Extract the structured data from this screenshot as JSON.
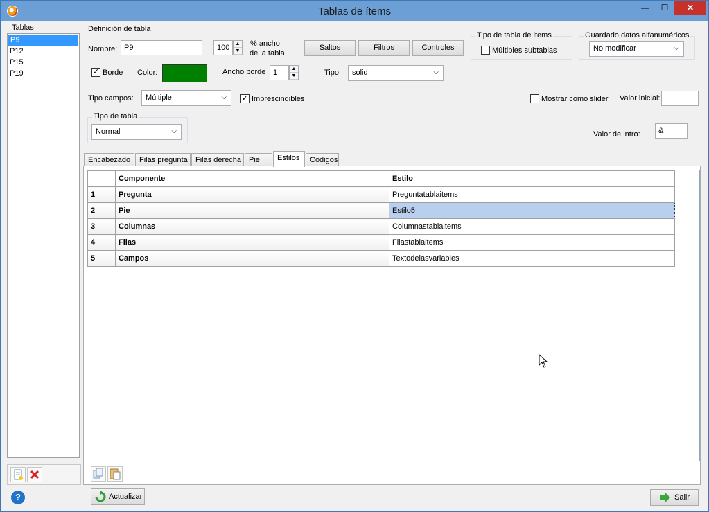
{
  "window": {
    "title": "Tablas de ítems"
  },
  "tablas": {
    "label": "Tablas",
    "items": [
      "P9",
      "P12",
      "P15",
      "P19"
    ],
    "selected": "P9"
  },
  "definicion": {
    "label": "Definición de tabla",
    "nombre_label": "Nombre:",
    "nombre_value": "P9",
    "ancho_value": "100",
    "ancho_label_1": "% ancho",
    "ancho_label_2": "de la tabla",
    "saltos": "Saltos",
    "filtros": "Filtros",
    "controles": "Controles",
    "tipo_tabla_items_label": "Tipo de tabla de items",
    "multiples_subtablas": "Múltiples subtablas",
    "guardado_label": "Guardado datos alfanuméricos",
    "guardado_value": "No modificar",
    "borde_label": "Borde",
    "color_label": "Color:",
    "color_value": "#008000",
    "ancho_borde_label": "Ancho borde",
    "ancho_borde_value": "1",
    "tipo_label": "Tipo",
    "tipo_value": "solid",
    "tipo_campos_label": "Tipo campos:",
    "tipo_campos_value": "Múltiple",
    "imprescindibles": "Imprescindibles",
    "mostrar_slider": "Mostrar como slider",
    "valor_inicial_label": "Valor inicial:",
    "valor_inicial_value": "",
    "tipo_de_tabla_label": "Tipo de tabla",
    "tipo_de_tabla_value": "Normal",
    "valor_intro_label": "Valor  de intro:",
    "valor_intro_value": "&"
  },
  "tabs": [
    {
      "label": "Encabezado"
    },
    {
      "label": "Filas pregunta"
    },
    {
      "label": "Filas derecha"
    },
    {
      "label": "Pie"
    },
    {
      "label": "Estilos"
    },
    {
      "label": "Codigos"
    }
  ],
  "grid": {
    "headers": {
      "componente": "Componente",
      "estilo": "Estilo"
    },
    "rows": [
      {
        "n": "1",
        "componente": "Pregunta",
        "estilo": "Preguntatablaitems"
      },
      {
        "n": "2",
        "componente": "Pie",
        "estilo": "Estilo5"
      },
      {
        "n": "3",
        "componente": "Columnas",
        "estilo": "Columnastablaitems"
      },
      {
        "n": "4",
        "componente": "Filas",
        "estilo": "Filastablaitems"
      },
      {
        "n": "5",
        "componente": "Campos",
        "estilo": "Textodelasvariables"
      }
    ]
  },
  "footer": {
    "actualizar": "Actualizar",
    "salir": "Salir"
  }
}
